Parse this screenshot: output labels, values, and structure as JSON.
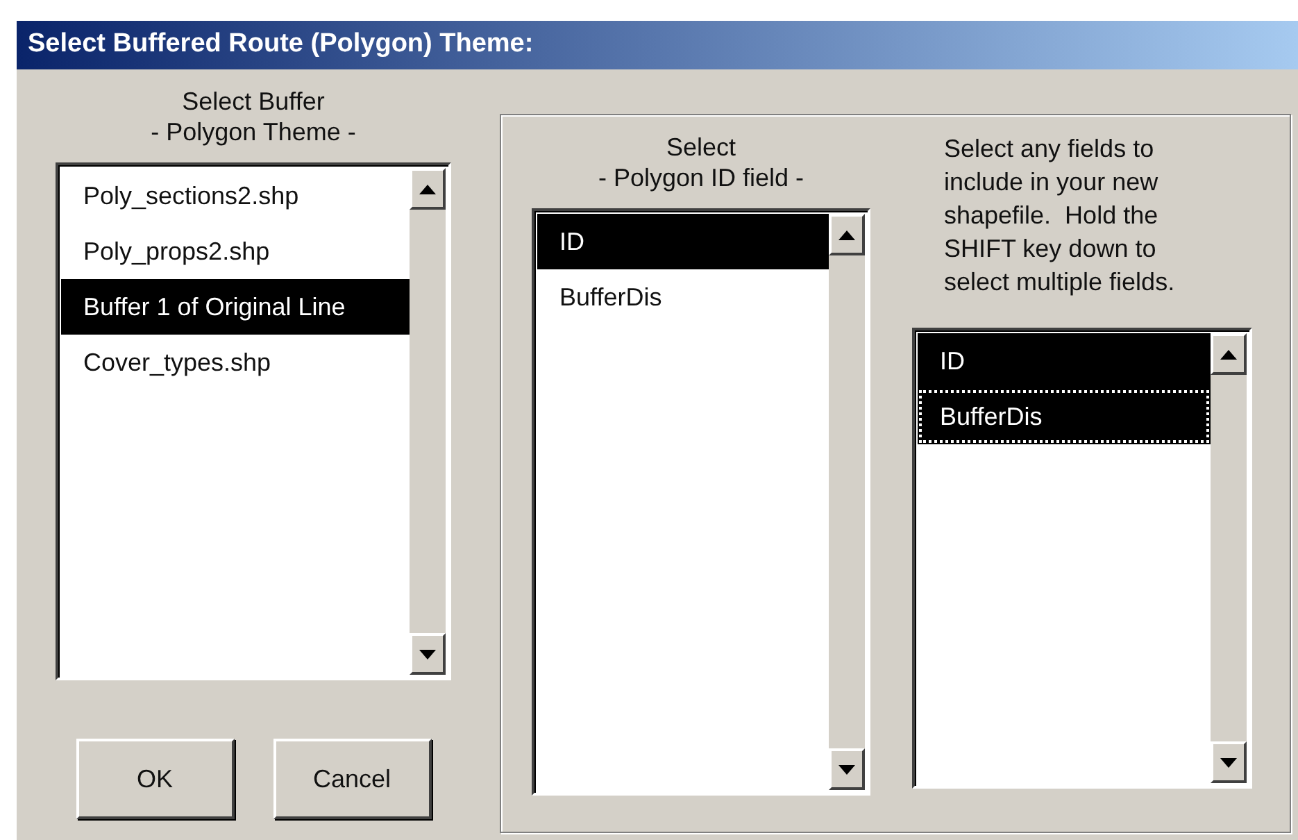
{
  "window": {
    "title": "Select Buffered Route (Polygon) Theme:"
  },
  "buffer_theme": {
    "label_lines": [
      "Select Buffer",
      "- Polygon Theme -"
    ],
    "items": [
      {
        "label": "Poly_sections2.shp",
        "selected": false
      },
      {
        "label": "Poly_props2.shp",
        "selected": false
      },
      {
        "label": "Buffer 1 of Original Line",
        "selected": true
      },
      {
        "label": "Cover_types.shp",
        "selected": false
      }
    ]
  },
  "buttons": [
    "OK",
    "Cancel"
  ],
  "id_field": {
    "label_lines": [
      "Select",
      "- Polygon ID field -"
    ],
    "items": [
      {
        "label": "ID",
        "selected": true
      },
      {
        "label": "BufferDis",
        "selected": false
      }
    ]
  },
  "include_fields": {
    "instruction_lines": [
      "Select any fields to",
      "include in your new",
      "shapefile.  Hold the",
      "SHIFT key down to",
      "select multiple fields."
    ],
    "items": [
      {
        "label": "ID",
        "selected": true,
        "focused": false
      },
      {
        "label": "BufferDis",
        "selected": true,
        "focused": true
      }
    ]
  }
}
